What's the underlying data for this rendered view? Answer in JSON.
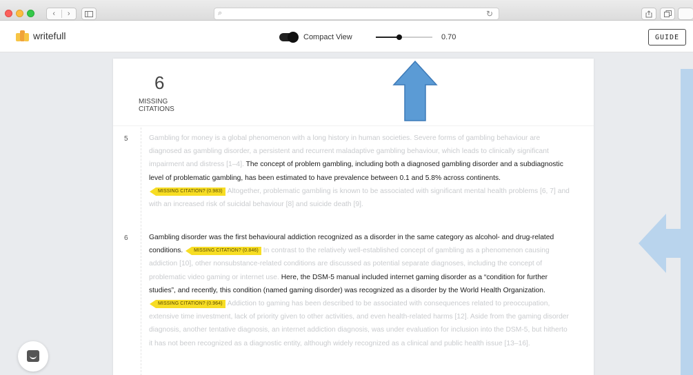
{
  "browser": {
    "back_icon": "‹",
    "forward_icon": "›",
    "search_icon": "⌕",
    "reload_icon": "↻"
  },
  "app": {
    "logo_text": "writefull",
    "compact_view_label": "Compact View",
    "compact_view_on": true,
    "threshold_value": "0.70",
    "threshold_fraction": 0.42,
    "guide_label": "GUIDE"
  },
  "summary": {
    "count": "6",
    "label_line1": "MISSING",
    "label_line2": "CITATIONS"
  },
  "paragraphs": [
    {
      "number": "5",
      "segments": [
        {
          "text": "Gambling for money is a global phenomenon with a long history in human societies. Severe forms of gambling behaviour are diagnosed as gambling disorder, a persistent and recurrent maladaptive gambling behaviour, which leads to clinically significant impairment and distress [1–4]. ",
          "style": "dim"
        },
        {
          "text": "The concept of problem gambling, including both a diagnosed gambling disorder and a subdiagnostic level of problematic gambling, has been estimated to have prevalence between 0.1 and 5.8% across continents.",
          "style": "hl"
        },
        {
          "text": "MISSING CITATION? (0.983)",
          "style": "tag"
        },
        {
          "text": "Altogether, problematic gambling is known to be associated with significant mental health problems [6, 7] and with an increased risk of suicidal behaviour [8] and suicide death [9].",
          "style": "dim"
        }
      ]
    },
    {
      "number": "6",
      "segments": [
        {
          "text": "Gambling disorder was the first behavioural addiction recognized as a disorder in the same category as alcohol- and drug-related conditions.",
          "style": "hl"
        },
        {
          "text": "MISSING CITATION? (0.846)",
          "style": "tag"
        },
        {
          "text": "In contrast to the relatively well-established concept of gambling as a phenomenon causing addiction [10], other nonsubstance-related conditions are discussed as potential separate diagnoses, including the concept of problematic video gaming or internet use. ",
          "style": "dim"
        },
        {
          "text": "Here, the DSM-5 manual included internet gaming disorder as a “condition for further studies”, and recently, this condition (named gaming disorder) was recognized as a disorder by the World Health Organization.",
          "style": "hl"
        },
        {
          "text": "MISSING CITATION? (0.964)",
          "style": "tag"
        },
        {
          "text": "Addiction to gaming has been described to be associated with consequences related to preoccupation, extensive time investment, lack of priority given to other activities, and even health-related harms [12]. Aside from the gaming disorder diagnosis, another tentative diagnosis, an internet addiction diagnosis, was under evaluation for inclusion into the DSM-5, but hitherto it has not been recognized as a diagnostic entity, although widely recognized as a clinical and public health issue [13–16].",
          "style": "dim"
        }
      ]
    }
  ],
  "colors": {
    "citation_tag": "#f7dd24",
    "arrow_fill": "#5b9bd5",
    "arrow_light": "#b9d4ed"
  },
  "icons": {
    "chat": "chat-bubble-icon",
    "share": "share-icon",
    "tabs": "tabs-icon",
    "sidebar": "sidebar-icon"
  }
}
